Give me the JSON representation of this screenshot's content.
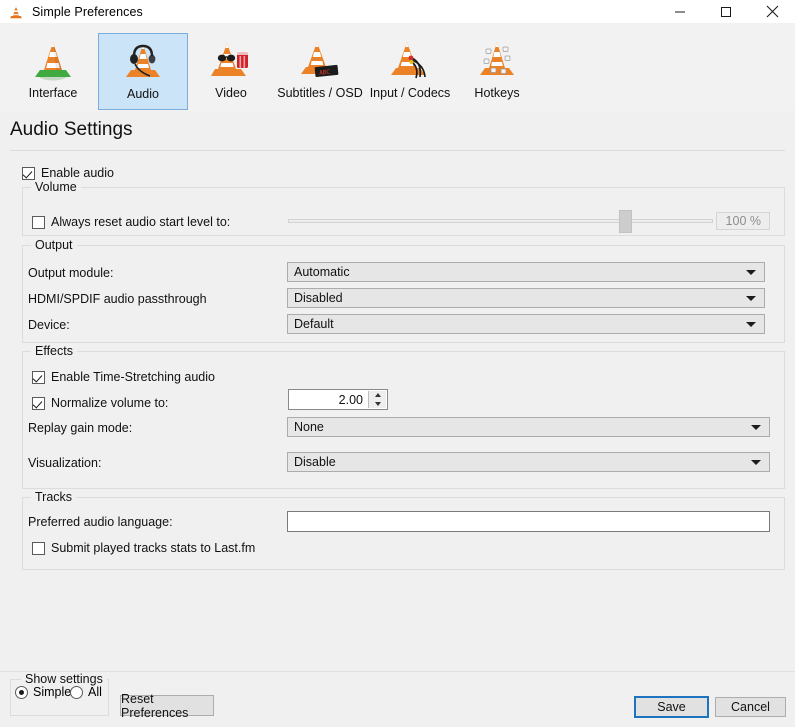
{
  "window": {
    "title": "Simple Preferences",
    "app_icon": "vlc-cone-icon",
    "minimize_label": "Minimize",
    "maximize_label": "Maximize",
    "close_label": "Close"
  },
  "toolbar": {
    "items": [
      {
        "label": "Interface",
        "icon": "vlc-cone-icon",
        "selected": false
      },
      {
        "label": "Audio",
        "icon": "vlc-cone-headphones-icon",
        "selected": true
      },
      {
        "label": "Video",
        "icon": "vlc-cone-glasses-icon",
        "selected": false
      },
      {
        "label": "Subtitles / OSD",
        "icon": "vlc-cone-marquee-icon",
        "selected": false
      },
      {
        "label": "Input / Codecs",
        "icon": "vlc-cone-cables-icon",
        "selected": false
      },
      {
        "label": "Hotkeys",
        "icon": "vlc-cone-keys-icon",
        "selected": false
      }
    ]
  },
  "page": {
    "title": "Audio Settings",
    "enable_audio": {
      "label": "Enable audio",
      "checked": true
    }
  },
  "volume": {
    "group_label": "Volume",
    "always_reset": {
      "label": "Always reset audio start level to:",
      "checked": false
    },
    "slider": {
      "value": 100,
      "min": 0,
      "max": 125,
      "percent_text": "100 %"
    }
  },
  "output": {
    "group_label": "Output",
    "rows": [
      {
        "label": "Output module:",
        "value": "Automatic"
      },
      {
        "label": "HDMI/SPDIF audio passthrough",
        "value": "Disabled"
      },
      {
        "label": "Device:",
        "value": "Default"
      }
    ]
  },
  "effects": {
    "group_label": "Effects",
    "time_stretching": {
      "label": "Enable Time-Stretching audio",
      "checked": true
    },
    "normalize": {
      "label": "Normalize volume to:",
      "checked": true,
      "value": "2.00"
    },
    "replay_gain": {
      "label": "Replay gain mode:",
      "value": "None"
    },
    "visualization": {
      "label": "Visualization:",
      "value": "Disable"
    }
  },
  "tracks": {
    "group_label": "Tracks",
    "preferred_language": {
      "label": "Preferred audio language:",
      "value": "",
      "placeholder": ""
    },
    "lastfm": {
      "label": "Submit played tracks stats to Last.fm",
      "checked": false
    }
  },
  "footer": {
    "show_settings_label": "Show settings",
    "simple_label": "Simple",
    "all_label": "All",
    "selected_mode": "Simple",
    "reset_label": "Reset Preferences",
    "save_label": "Save",
    "cancel_label": "Cancel"
  }
}
